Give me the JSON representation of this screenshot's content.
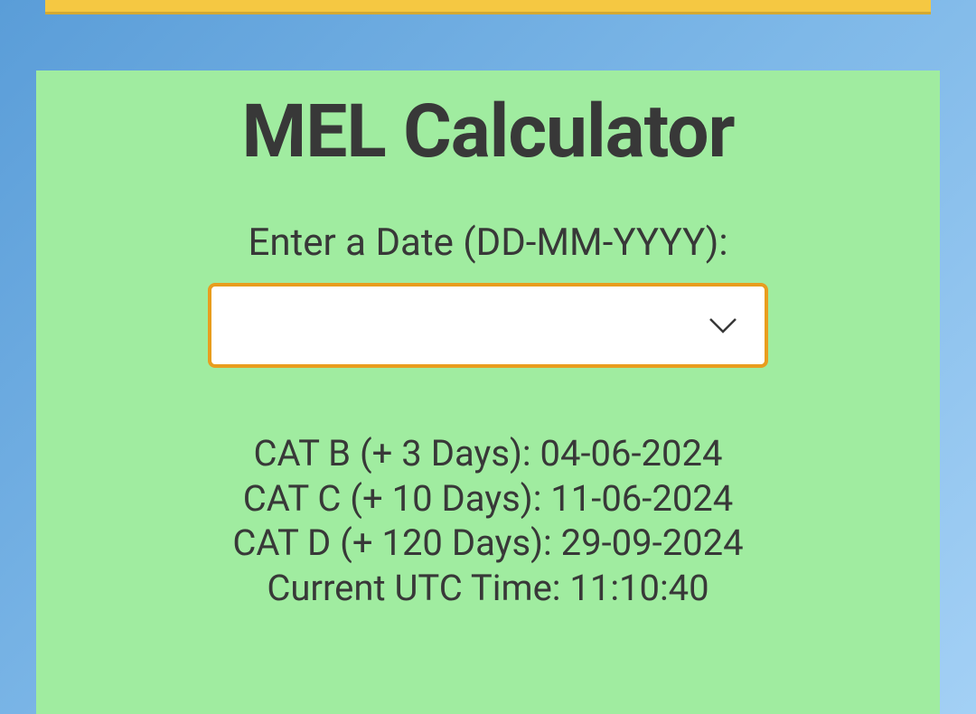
{
  "title": "MEL Calculator",
  "inputLabel": "Enter a Date (DD-MM-YYYY):",
  "dateValue": "",
  "results": {
    "catB": "CAT B (+ 3 Days): 04-06-2024",
    "catC": "CAT C (+ 10 Days): 11-06-2024",
    "catD": "CAT D (+ 120 Days): 29-09-2024",
    "utcTime": "Current UTC Time: 11:10:40"
  }
}
